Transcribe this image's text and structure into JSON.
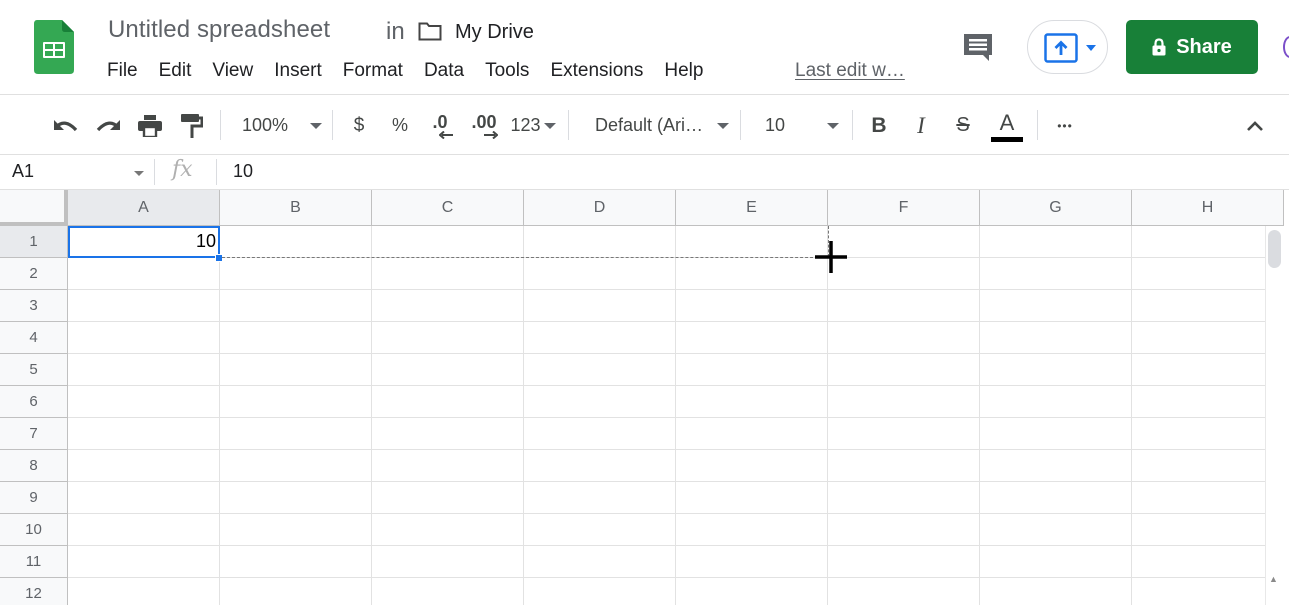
{
  "header": {
    "doc_title": "Untitled spreadsheet",
    "in_label": "in",
    "folder": "My Drive",
    "menu": [
      "File",
      "Edit",
      "View",
      "Insert",
      "Format",
      "Data",
      "Tools",
      "Extensions",
      "Help"
    ],
    "last_edit": "Last edit w…",
    "share_label": "Share",
    "brand_color": "#188038",
    "logo_color": "#34a853"
  },
  "toolbar": {
    "zoom": "100%",
    "currency": "$",
    "percent": "%",
    "decrease_decimal": ".0",
    "increase_decimal": ".00",
    "more_formats": "123",
    "font": "Default (Ari…",
    "font_size": "10",
    "bold": "B",
    "italic": "I",
    "strikethrough": "S",
    "text_color": "A",
    "more": "•••"
  },
  "formula_bar": {
    "name_box": "A1",
    "fx": "fx",
    "value": "10"
  },
  "sheet": {
    "columns": [
      "A",
      "B",
      "C",
      "D",
      "E",
      "F",
      "G",
      "H"
    ],
    "rows": [
      "1",
      "2",
      "3",
      "4",
      "5",
      "6",
      "7",
      "8",
      "9",
      "10",
      "11",
      "12"
    ],
    "selected_cell": "A1",
    "cells": {
      "A1": "10"
    },
    "selection_color": "#1a73e8"
  }
}
